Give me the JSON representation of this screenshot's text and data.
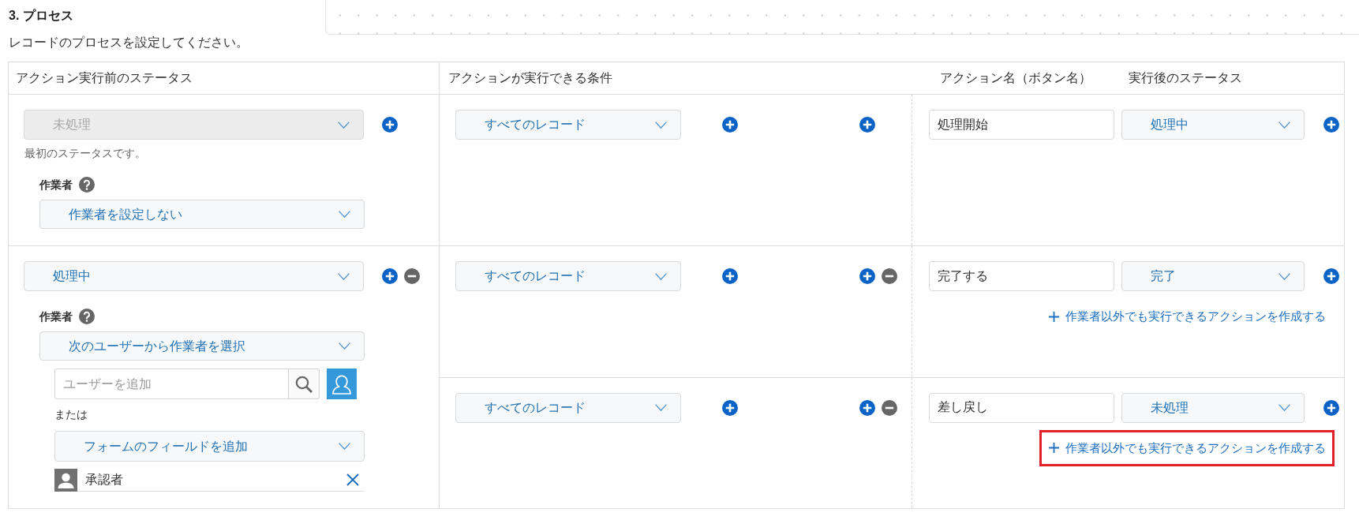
{
  "section": {
    "title": "3. プロセス",
    "description": "レコードのプロセスを設定してください。"
  },
  "table": {
    "columns": [
      "アクション実行前のステータス",
      "アクションが実行できる条件",
      "アクション名（ボタン名）",
      "実行後のステータス"
    ],
    "rows": [
      {
        "status": {
          "value": "未処理",
          "disabled": true
        },
        "note": "最初のステータスです。",
        "removable": false,
        "assignee": {
          "label": "作業者",
          "mode": "作業者を設定しない"
        },
        "actions": [
          {
            "condition": "すべてのレコード",
            "removable": false,
            "name": "処理開始",
            "next_status": "処理中"
          }
        ]
      },
      {
        "status": {
          "value": "処理中",
          "disabled": false
        },
        "removable": true,
        "assignee": {
          "label": "作業者",
          "mode": "次のユーザーから作業者を選択",
          "user_search": {
            "placeholder": "ユーザーを追加"
          },
          "or_label": "または",
          "field_select": "フォームのフィールドを追加",
          "entries": [
            {
              "name": "承認者"
            }
          ]
        },
        "actions": [
          {
            "condition": "すべてのレコード",
            "removable": true,
            "name": "完了する",
            "next_status": "完了",
            "link": {
              "label": "作業者以外でも実行できるアクションを作成する",
              "highlighted": false
            }
          },
          {
            "condition": "すべてのレコード",
            "removable": true,
            "name": "差し戻し",
            "next_status": "未処理",
            "link": {
              "label": "作業者以外でも実行できるアクションを作成する",
              "highlighted": true
            }
          }
        ]
      }
    ]
  }
}
